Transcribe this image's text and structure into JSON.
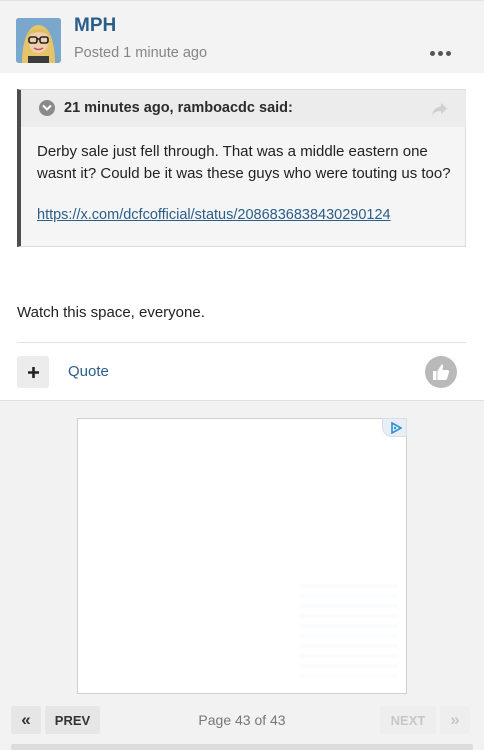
{
  "post": {
    "author": "MPH",
    "posted": "Posted 1 minute ago",
    "more_icon": "ellipsis-icon",
    "quote": {
      "cite": "21 minutes ago, ramboacdc said:",
      "text": "Derby sale just fell through. That was a middle eastern one wasnt it? Could be it was these guys who were touting us too?",
      "link": "https://x.com/dcfcofficial/status/2086836838430290124"
    },
    "body": "Watch this space, everyone.",
    "actions": {
      "quote_label": "Quote"
    }
  },
  "pagination": {
    "prev_label": "PREV",
    "page_info": "Page 43 of 43",
    "next_label": "NEXT",
    "first_glyph": "«",
    "last_glyph": "»"
  },
  "colors": {
    "link": "#2a5d8a",
    "quote_border": "#4d4d4d",
    "disabled": "#c7c7c7"
  }
}
